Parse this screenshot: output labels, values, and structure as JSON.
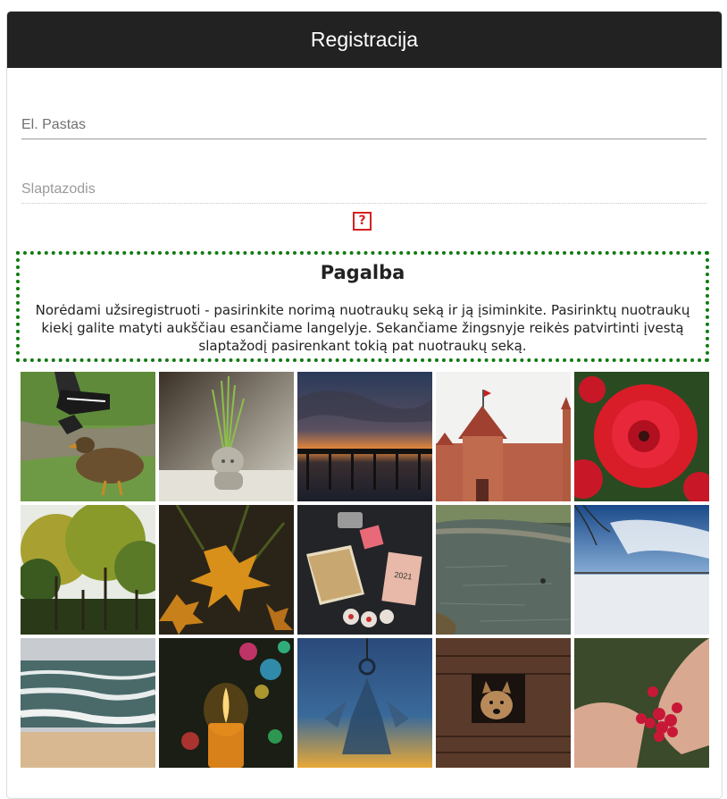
{
  "header": {
    "title": "Registracija"
  },
  "form": {
    "email_placeholder": "El. Pastas",
    "password_placeholder": "Slaptazodis",
    "help_button": "?"
  },
  "help": {
    "title": "Pagalba",
    "text": "Norėdami užsiregistruoti - pasirinkite norimą nuotraukų seką ir ją įsiminkite. Pasirinktų nuotraukų kiekį galite matyti aukščiau esančiame langelyje. Sekančiame žingsnyje reikės patvirtinti įvestą slaptažodį pasirenkant tokią pat nuotraukų seką."
  },
  "gallery": [
    "duck-photo",
    "plant-figure-photo",
    "pier-sunset-photo",
    "castle-photo",
    "red-rose-photo",
    "autumn-trees-photo",
    "maple-leaves-photo",
    "book-calendar-photo",
    "pond-photo",
    "snowy-field-photo",
    "sea-waves-photo",
    "candle-photo",
    "glass-angel-photo",
    "dog-kennel-photo",
    "raspberries-hands-photo"
  ],
  "colors": {
    "header_bg": "#222222",
    "help_border": "#107a10",
    "help_button": "#d42020"
  }
}
